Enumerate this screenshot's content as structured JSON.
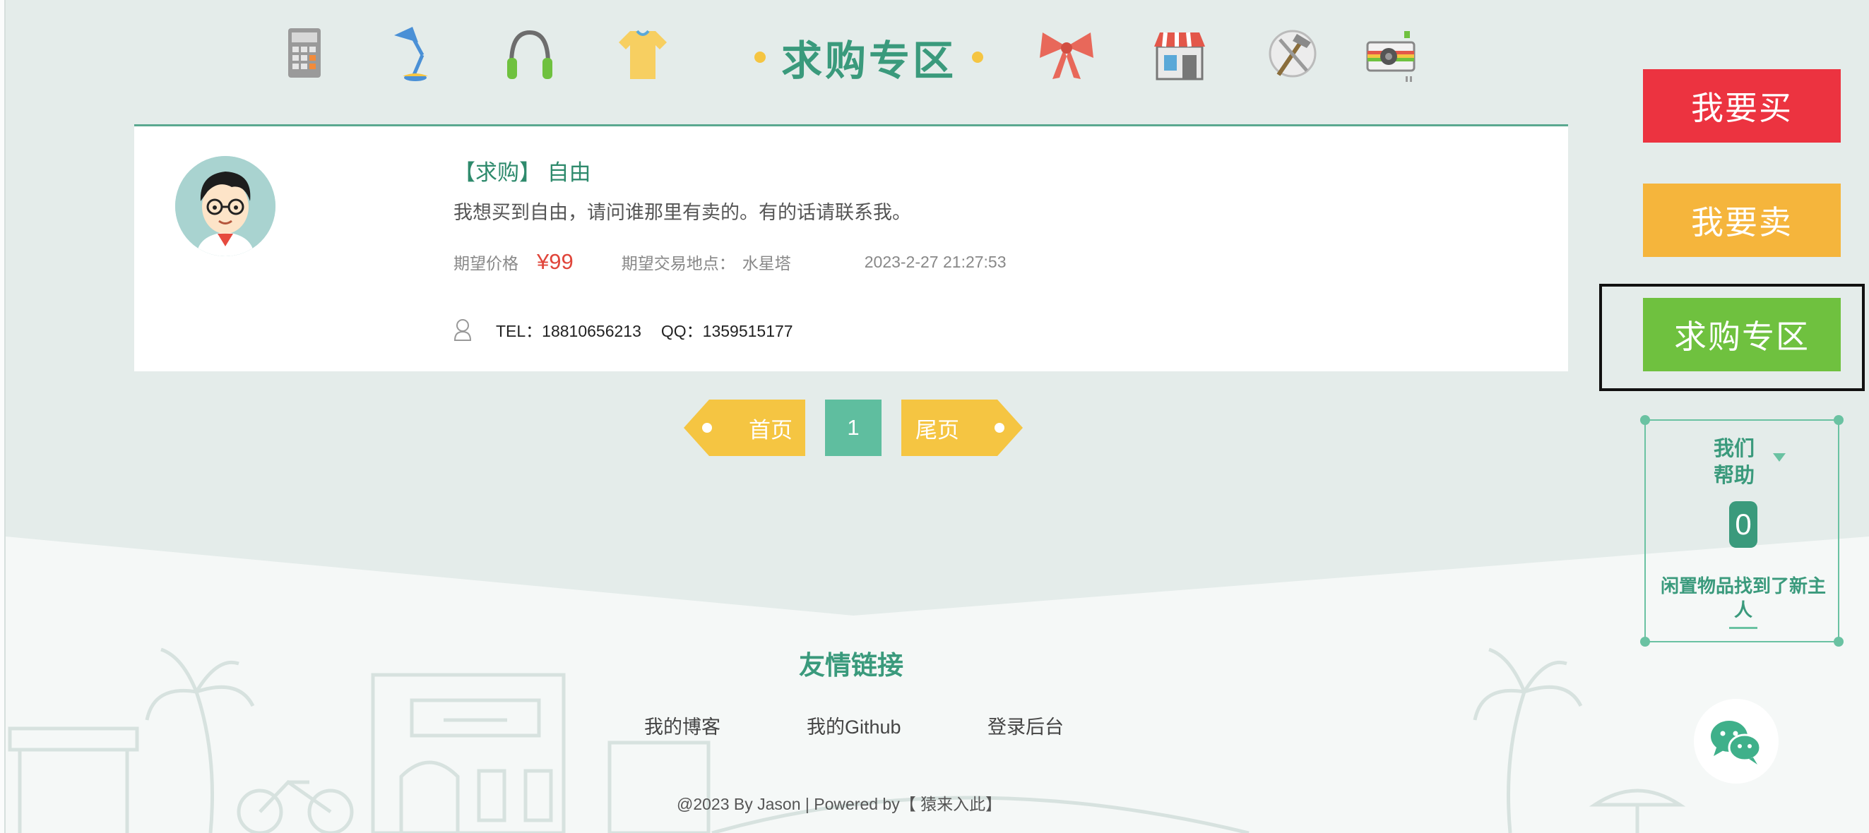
{
  "header": {
    "category_icons": [
      "calculator-icon",
      "desk-lamp-icon",
      "headphones-icon",
      "tshirt-icon",
      "bow-icon",
      "shop-icon",
      "tools-icon",
      "camera-icon"
    ],
    "zone_title": "求购专区"
  },
  "post": {
    "title": "【求购】 自由",
    "description": "我想买到自由，请问谁那里有卖的。有的话请联系我。",
    "price_label": "期望价格",
    "price": "¥99",
    "location_label": "期望交易地点：",
    "location": "水星塔",
    "datetime": "2023-2-27 21:27:53",
    "tel": "TEL：18810656213",
    "qq": "QQ：1359515177"
  },
  "pagination": {
    "first": "首页",
    "current": "1",
    "last": "尾页"
  },
  "footer": {
    "links_title": "友情链接",
    "links": [
      "我的博客",
      "我的Github",
      "登录后台"
    ],
    "copyright": "@2023 By Jason  |  Powered by【 猿来入此】"
  },
  "sidebar": {
    "buy_label": "我要买",
    "sell_label": "我要卖",
    "wanted_label": "求购专区",
    "help_title": "我们帮助",
    "help_count": "0",
    "help_caption": "闲置物品找到了新主人"
  },
  "colors": {
    "accent_green": "#3a9a7c",
    "buy_red": "#ec3340",
    "sell_orange": "#f5b53c",
    "wanted_green": "#6fc13f",
    "pager_yellow": "#f5c542",
    "price_red": "#e0453a"
  }
}
